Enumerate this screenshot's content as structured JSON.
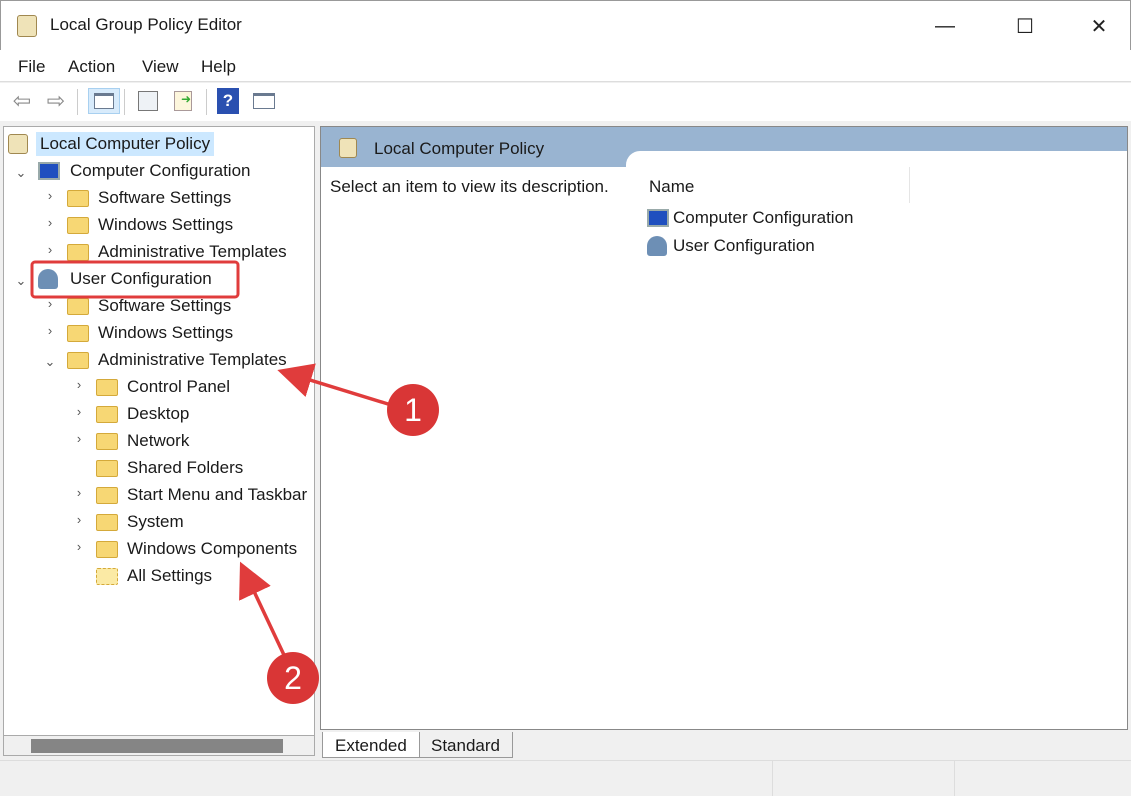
{
  "window": {
    "title": "Local Group Policy Editor",
    "minimize": "—",
    "maximize": "☐",
    "close": "✕"
  },
  "menu": [
    "File",
    "Action",
    "View",
    "Help"
  ],
  "toolbar": [
    "back-icon",
    "forward-icon",
    "show-hide-console-tree-icon",
    "properties-icon",
    "export-list-icon",
    "help-icon",
    "show-action-pane-icon"
  ],
  "tree": {
    "root": "Local Computer Policy",
    "computer": "Computer Configuration",
    "computer_children": [
      "Software Settings",
      "Windows Settings",
      "Administrative Templates"
    ],
    "user": "User Configuration",
    "user_children": [
      "Software Settings",
      "Windows Settings",
      "Administrative Templates"
    ],
    "admin_children": [
      "Control Panel",
      "Desktop",
      "Network",
      "Shared Folders",
      "Start Menu and Taskbar",
      "System",
      "Windows Components",
      "All Settings"
    ]
  },
  "right": {
    "header": "Local Computer Policy",
    "description": "Select an item to view its description.",
    "column": "Name",
    "items": [
      "Computer Configuration",
      "User Configuration"
    ]
  },
  "tabs": [
    "Extended",
    "Standard"
  ],
  "annotations": [
    "1",
    "2"
  ],
  "colors": {
    "highlight": "#cce8ff",
    "header": "#99b4d1",
    "annotation": "#e03c3c"
  }
}
